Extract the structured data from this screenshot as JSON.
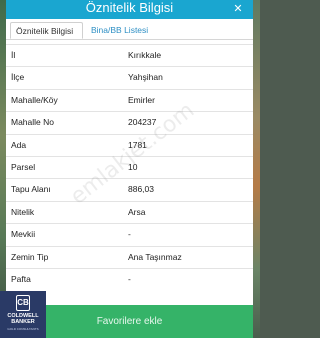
{
  "dialog": {
    "title": "Öznitelik Bilgisi",
    "close_icon": "close-icon"
  },
  "tabs": [
    {
      "label": "Öznitelik Bilgisi",
      "active": true
    },
    {
      "label": "Bina/BB Listesi",
      "active": false
    }
  ],
  "rows": [
    {
      "label": "İl",
      "value": "Kırıkkale"
    },
    {
      "label": "İlçe",
      "value": "Yahşihan"
    },
    {
      "label": "Mahalle/Köy",
      "value": "Emirler"
    },
    {
      "label": "Mahalle No",
      "value": "204237"
    },
    {
      "label": "Ada",
      "value": "1781"
    },
    {
      "label": "Parsel",
      "value": "10"
    },
    {
      "label": "Tapu Alanı",
      "value": "886,03"
    },
    {
      "label": "Nitelik",
      "value": "Arsa"
    },
    {
      "label": "Mevkii",
      "value": "-"
    },
    {
      "label": "Zemin Tip",
      "value": "Ana Taşınmaz"
    },
    {
      "label": "Pafta",
      "value": "-"
    }
  ],
  "watermark": "emlakjet.com",
  "footer": {
    "favorite_button": "Favorilere ekle"
  },
  "logo": {
    "line1": "COLDWELL",
    "line2": "BANKER",
    "sub": "GOLD CONSULTANTS",
    "mark": "CB"
  },
  "colors": {
    "titlebar": "#1aa6d0",
    "footer": "#35b368",
    "tab_link": "#2e8fc4",
    "logo_bg": "#2a3a66"
  }
}
